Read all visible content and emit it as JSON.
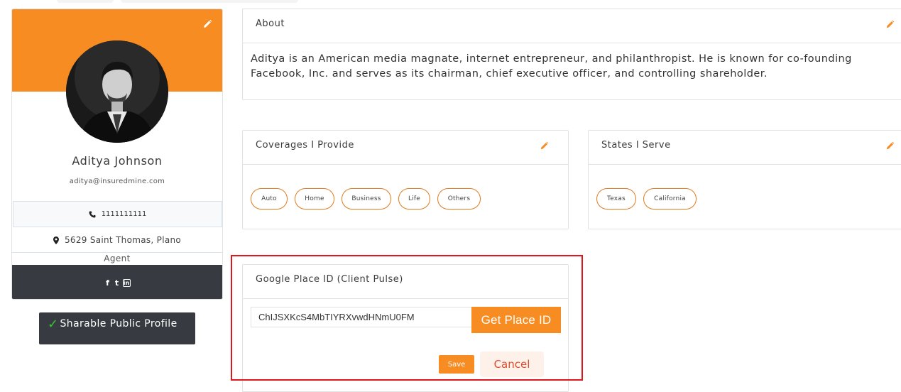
{
  "colors": {
    "accent": "#f68c22",
    "dark": "#373b41",
    "highlight_border": "#e0161d",
    "check": "#39c235"
  },
  "profile": {
    "name": "Aditya Johnson",
    "email": "aditya@insuredmine.com",
    "phone": "1111111111",
    "address": "5629 Saint Thomas, Plano",
    "role": "Agent",
    "social_icons": [
      "facebook-icon",
      "twitter-icon",
      "linkedin-icon"
    ],
    "social_glyphs": {
      "facebook": "f",
      "twitter": "t",
      "linkedin": "in"
    },
    "share_label": "Sharable Public Profile"
  },
  "about": {
    "title": "About",
    "text": "Aditya is an American media magnate, internet entrepreneur, and philanthropist. He is known for co-founding Facebook, Inc. and serves as its chairman, chief executive officer, and controlling shareholder."
  },
  "coverages": {
    "title": "Coverages I Provide",
    "items": [
      "Auto",
      "Home",
      "Business",
      "Life",
      "Others"
    ]
  },
  "states": {
    "title": "States I Serve",
    "items": [
      "Texas",
      "California"
    ]
  },
  "google_place": {
    "title": "Google Place ID (Client Pulse)",
    "value": "ChIJSXKcS4MbTIYRXvwdHNmU0FM",
    "get_button": "Get Place ID",
    "save_button": "Save",
    "cancel_button": "Cancel"
  }
}
